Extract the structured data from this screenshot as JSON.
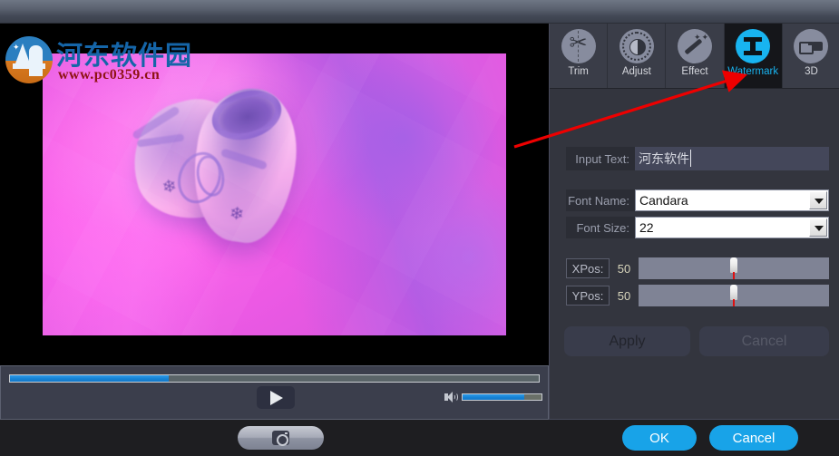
{
  "window": {
    "title_bar": ""
  },
  "watermark_overlay": {
    "site_name": "河东软件园",
    "site_url": "www.pc0359.cn",
    "logo_icon": "site-logo-icon"
  },
  "preview": {
    "description": "video-preview-baby-shoes",
    "name": "video-preview"
  },
  "transport": {
    "seek": {
      "label": "seek-bar",
      "progress_percent": 30
    },
    "play_button_icon": "play-icon",
    "volume": {
      "icon": "volume-icon",
      "level_percent": 78
    }
  },
  "bottom_bar": {
    "snapshot_icon": "camera-icon",
    "ok_label": "OK",
    "cancel_label": "Cancel"
  },
  "tabs": [
    {
      "label": "Trim",
      "icon": "scissors-icon",
      "active": false
    },
    {
      "label": "Adjust",
      "icon": "brightness-icon",
      "active": false
    },
    {
      "label": "Effect",
      "icon": "magic-wand-icon",
      "active": false
    },
    {
      "label": "Watermark",
      "icon": "watermark-icon",
      "active": true
    },
    {
      "label": "3D",
      "icon": "glasses-3d-icon",
      "active": false
    }
  ],
  "watermark_panel": {
    "input_text": {
      "label": "Input Text:",
      "value": "河东软件园",
      "display_value": "河东软件"
    },
    "font_name": {
      "label": "Font Name:",
      "value": "Candara",
      "arrow_icon": "chevron-down-icon"
    },
    "font_size": {
      "label": "Font Size:",
      "value": "22",
      "arrow_icon": "chevron-down-icon"
    },
    "xpos": {
      "label": "XPos:",
      "value": "50",
      "percent": 50
    },
    "ypos": {
      "label": "YPos:",
      "value": "50",
      "percent": 50
    },
    "apply_label": "Apply",
    "cancel_label": "Cancel"
  },
  "colors": {
    "accent_blue": "#18a3e8",
    "tab_active_icon": "#18b4f0",
    "panel_bg": "#33353e",
    "arrow_annotation": "#ee0000",
    "slider_track": "#7f8395",
    "slider_marker": "#e01010"
  }
}
